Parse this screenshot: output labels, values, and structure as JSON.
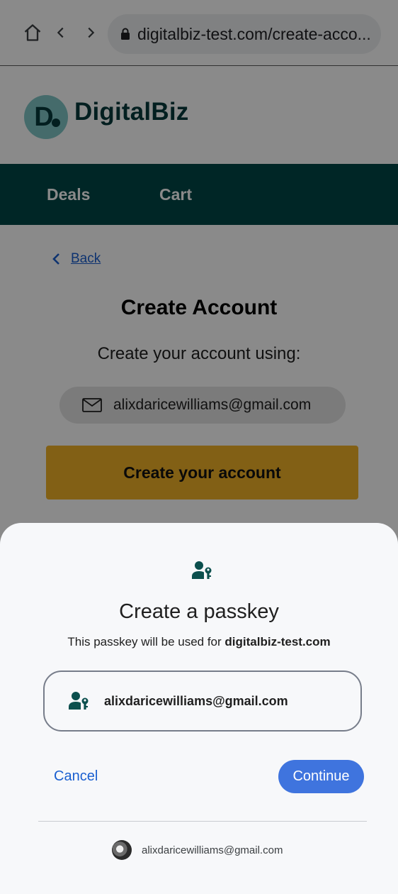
{
  "browser": {
    "url": "digitalbiz-test.com/create-acco..."
  },
  "site": {
    "logo_letter": "D",
    "logo_text": "DigitalBiz",
    "nav": [
      "Deals",
      "Cart"
    ],
    "back_label": "Back",
    "title": "Create Account",
    "subtitle": "Create your account using:",
    "email": "alixdaricewilliams@gmail.com",
    "create_button": "Create your account"
  },
  "sheet": {
    "title": "Create a passkey",
    "description_prefix": "This passkey will be used for ",
    "description_domain": "digitalbiz-test.com",
    "account": "alixdaricewilliams@gmail.com",
    "cancel": "Cancel",
    "continue": "Continue",
    "footer_account": "alixdaricewilliams@gmail.com"
  },
  "icons": {
    "home": "home-icon",
    "back": "chevron-left-icon",
    "forward": "chevron-right-icon",
    "lock": "lock-icon",
    "mail": "mail-icon",
    "passkey": "passkey-icon",
    "avatar": "avatar"
  },
  "colors": {
    "brand_dark": "#004747",
    "accent_yellow": "#f0b127",
    "link_blue": "#1a5fd0",
    "button_blue": "#3f74de"
  }
}
